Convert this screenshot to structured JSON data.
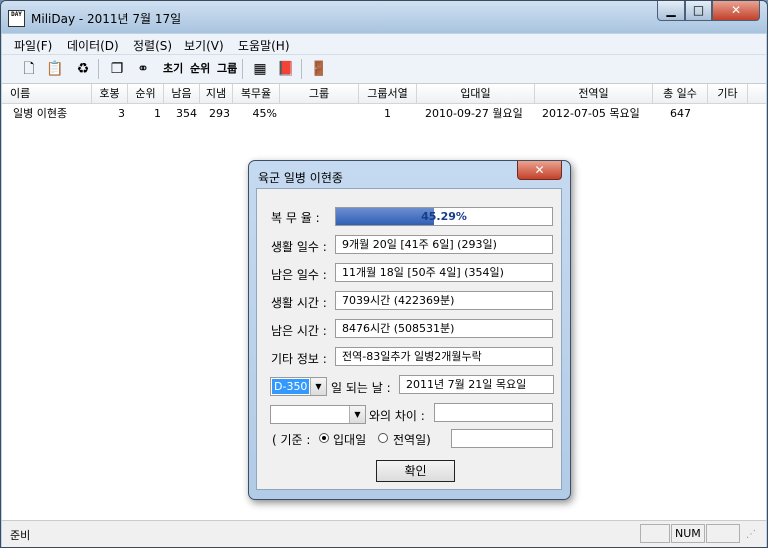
{
  "window": {
    "icon_text": "DAY",
    "title": "MiliDay - 2011년 7월 17일"
  },
  "menu": [
    "파일(F)",
    "데이터(D)",
    "정렬(S)",
    "보기(V)",
    "도움말(H)"
  ],
  "toolbar": {
    "buttons": [
      "new-file-icon",
      "open-icon",
      "recycle-icon",
      "copy-icon",
      "binoculars-icon",
      "calculator-icon",
      "book-icon",
      "exit-door-icon"
    ],
    "text_buttons": [
      "초기",
      "순위",
      "그룹"
    ]
  },
  "listview": {
    "columns": [
      "이름",
      "호봉",
      "순위",
      "남음",
      "지냄",
      "복무율",
      "그룹",
      "그룹서열",
      "입대일",
      "전역일",
      "총 일수",
      "기타"
    ],
    "rows": [
      [
        "일병 이현종",
        "3",
        "1",
        "354",
        "293",
        "45%",
        "",
        "1",
        "2010-09-27 월요일",
        "2012-07-05 목요일",
        "647",
        ""
      ]
    ]
  },
  "statusbar": {
    "text": "준비",
    "num": "NUM"
  },
  "dialog": {
    "title": "육군 일병 이현종",
    "close": "✕",
    "labels": {
      "rate": "복 무 율 :",
      "lived_days": "생활 일수 :",
      "left_days": "남은 일수 :",
      "lived_time": "생활 시간 :",
      "left_time": "남은 시간 :",
      "etc": "기타 정보 :",
      "day_of": "일 되는 날 :",
      "diff": "와의 차이 :",
      "base_open": "( 기준 :",
      "enlist": "입대일",
      "discharge": "전역일)"
    },
    "rate_value": "45.29%",
    "rate_fraction": 0.4529,
    "lived_days_value": "9개월 20일 [41주 6일] (293일)",
    "left_days_value": "11개월 18일 [50주 4일] (354일)",
    "lived_time_value": "7039시간 (422369분)",
    "left_time_value": "8476시간 (508531분)",
    "etc_value": "전역-83일추가 일병2개월누락",
    "dday_select": "D-350",
    "dday_result": "2011년 7월 21일 목요일",
    "diff_select": "",
    "diff_result": "",
    "base_result": "",
    "ok": "확인"
  }
}
